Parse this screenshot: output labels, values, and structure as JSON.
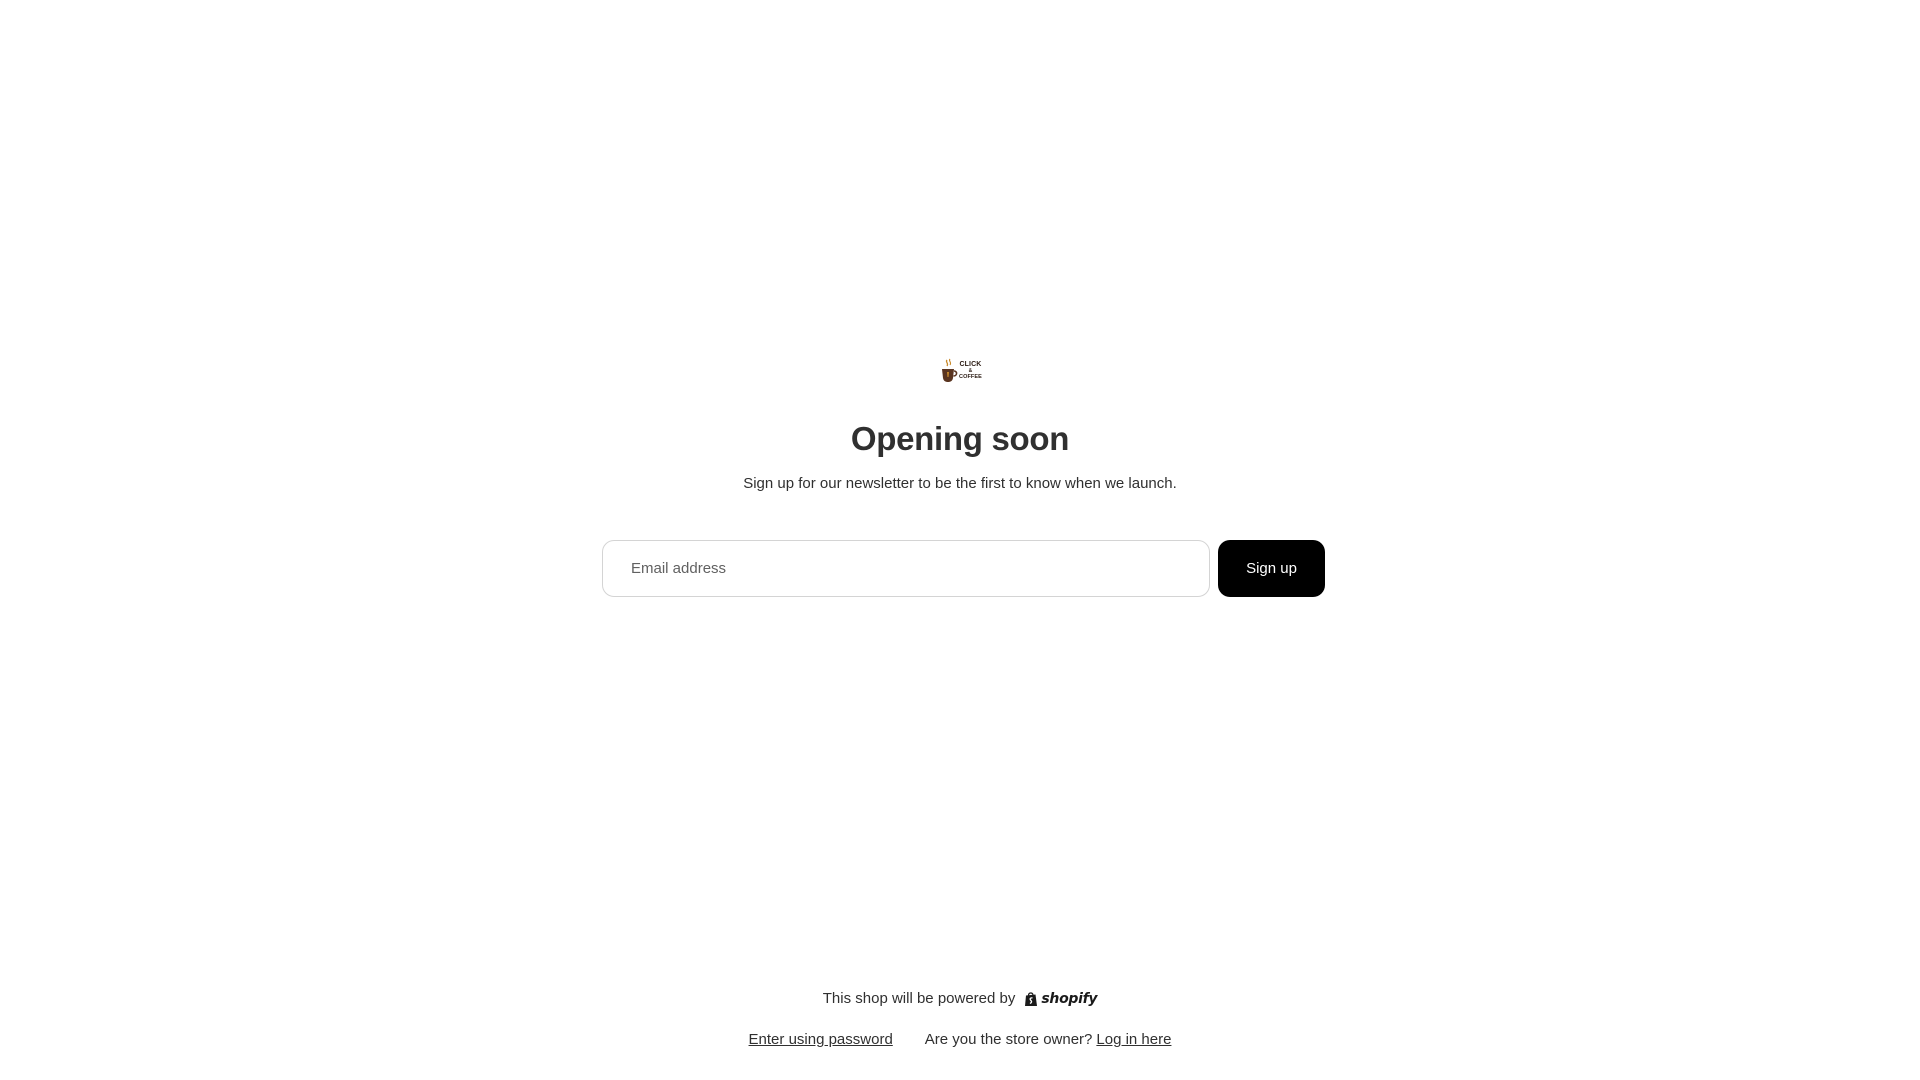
{
  "brand": {
    "logo_line1": "CLICK",
    "logo_line2": "&",
    "logo_line3": "COFFEE"
  },
  "hero": {
    "title": "Opening soon",
    "subtitle": "Sign up for our newsletter to be the first to know when we launch."
  },
  "newsletter": {
    "email_placeholder": "Email address",
    "email_value": "",
    "signup_label": "Sign up"
  },
  "footer": {
    "powered_by": "This shop will be powered by",
    "shopify_wordmark": "shopify",
    "enter_password_label": "Enter using password",
    "owner_question": "Are you the store owner?",
    "login_label": "Log in here"
  },
  "colors": {
    "text": "#303030",
    "button_bg": "#000000",
    "button_text": "#ffffff",
    "input_border": "#d4d4d4",
    "logo_cup": "#5a3420",
    "logo_steam": "#c98a2c"
  }
}
